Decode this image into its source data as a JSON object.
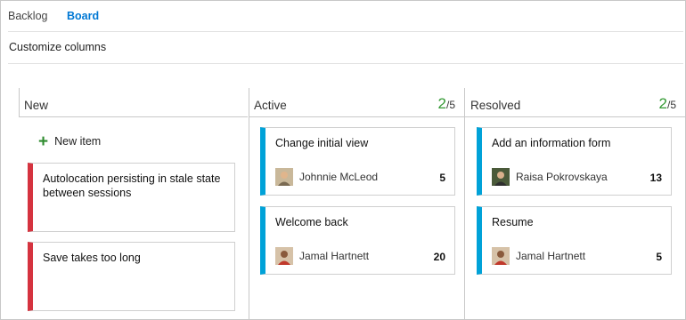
{
  "tabs": [
    {
      "label": "Backlog",
      "selected": false
    },
    {
      "label": "Board",
      "selected": true
    }
  ],
  "toolbar": {
    "customize_label": "Customize columns"
  },
  "columns": [
    {
      "title": "New",
      "new_item_label": "New item",
      "cards": [
        {
          "title": "Autolocation persisting in stale state between sessions",
          "type": "bug",
          "color": "#d5333f"
        },
        {
          "title": "Save takes too long",
          "type": "bug",
          "color": "#d5333f"
        }
      ]
    },
    {
      "title": "Active",
      "count": "2",
      "limit": "/5",
      "cards": [
        {
          "title": "Change initial view",
          "assignee": "Johnnie McLeod",
          "effort": "5",
          "color": "#00a2d8",
          "avatar_icon": "person-avatar-icon"
        },
        {
          "title": "Welcome back",
          "assignee": "Jamal Hartnett",
          "effort": "20",
          "color": "#00a2d8",
          "avatar_icon": "person-avatar-icon"
        }
      ]
    },
    {
      "title": "Resolved",
      "count": "2",
      "limit": "/5",
      "cards": [
        {
          "title": "Add an information form",
          "assignee": "Raisa Pokrovskaya",
          "effort": "13",
          "color": "#00a2d8",
          "avatar_icon": "person-avatar-icon"
        },
        {
          "title": "Resume",
          "assignee": "Jamal Hartnett",
          "effort": "5",
          "color": "#00a2d8",
          "avatar_icon": "person-avatar-icon"
        }
      ]
    }
  ],
  "colors": {
    "accent": "#0078d4",
    "count_ok": "#339933",
    "bug": "#d5333f",
    "story": "#00a2d8"
  }
}
